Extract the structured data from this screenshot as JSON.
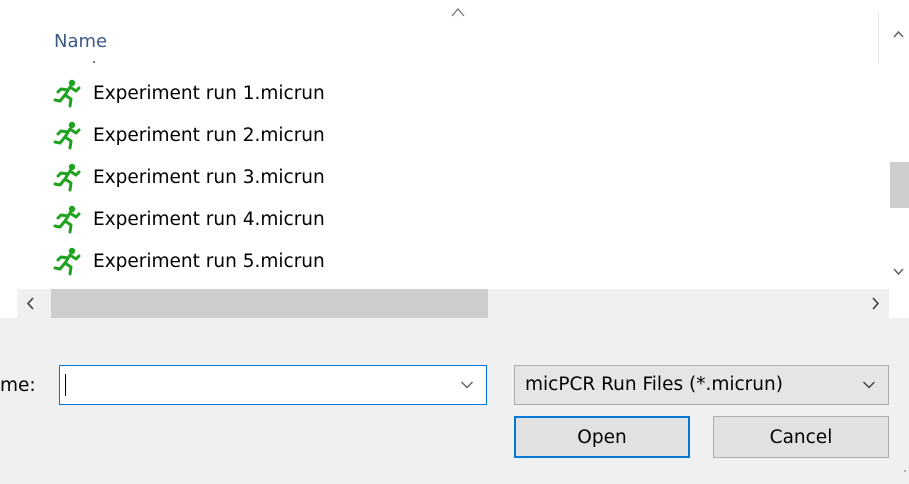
{
  "file_list": {
    "column_header": "Name",
    "sort_direction_icon": "chevron-up-icon",
    "item_icon": "running-man-icon",
    "item_icon_color": "#1fa21f",
    "items": [
      {
        "label": "Experiment run 1.micrun"
      },
      {
        "label": "Experiment run 2.micrun"
      },
      {
        "label": "Experiment run 3.micrun"
      },
      {
        "label": "Experiment run 4.micrun"
      },
      {
        "label": "Experiment run 5.micrun"
      }
    ]
  },
  "filename_field": {
    "label": "me:",
    "value": "",
    "accent_color": "#0078d7"
  },
  "file_type_select": {
    "selected": "micPCR Run Files (*.micrun)"
  },
  "buttons": {
    "open_label": "Open",
    "cancel_label": "Cancel"
  }
}
